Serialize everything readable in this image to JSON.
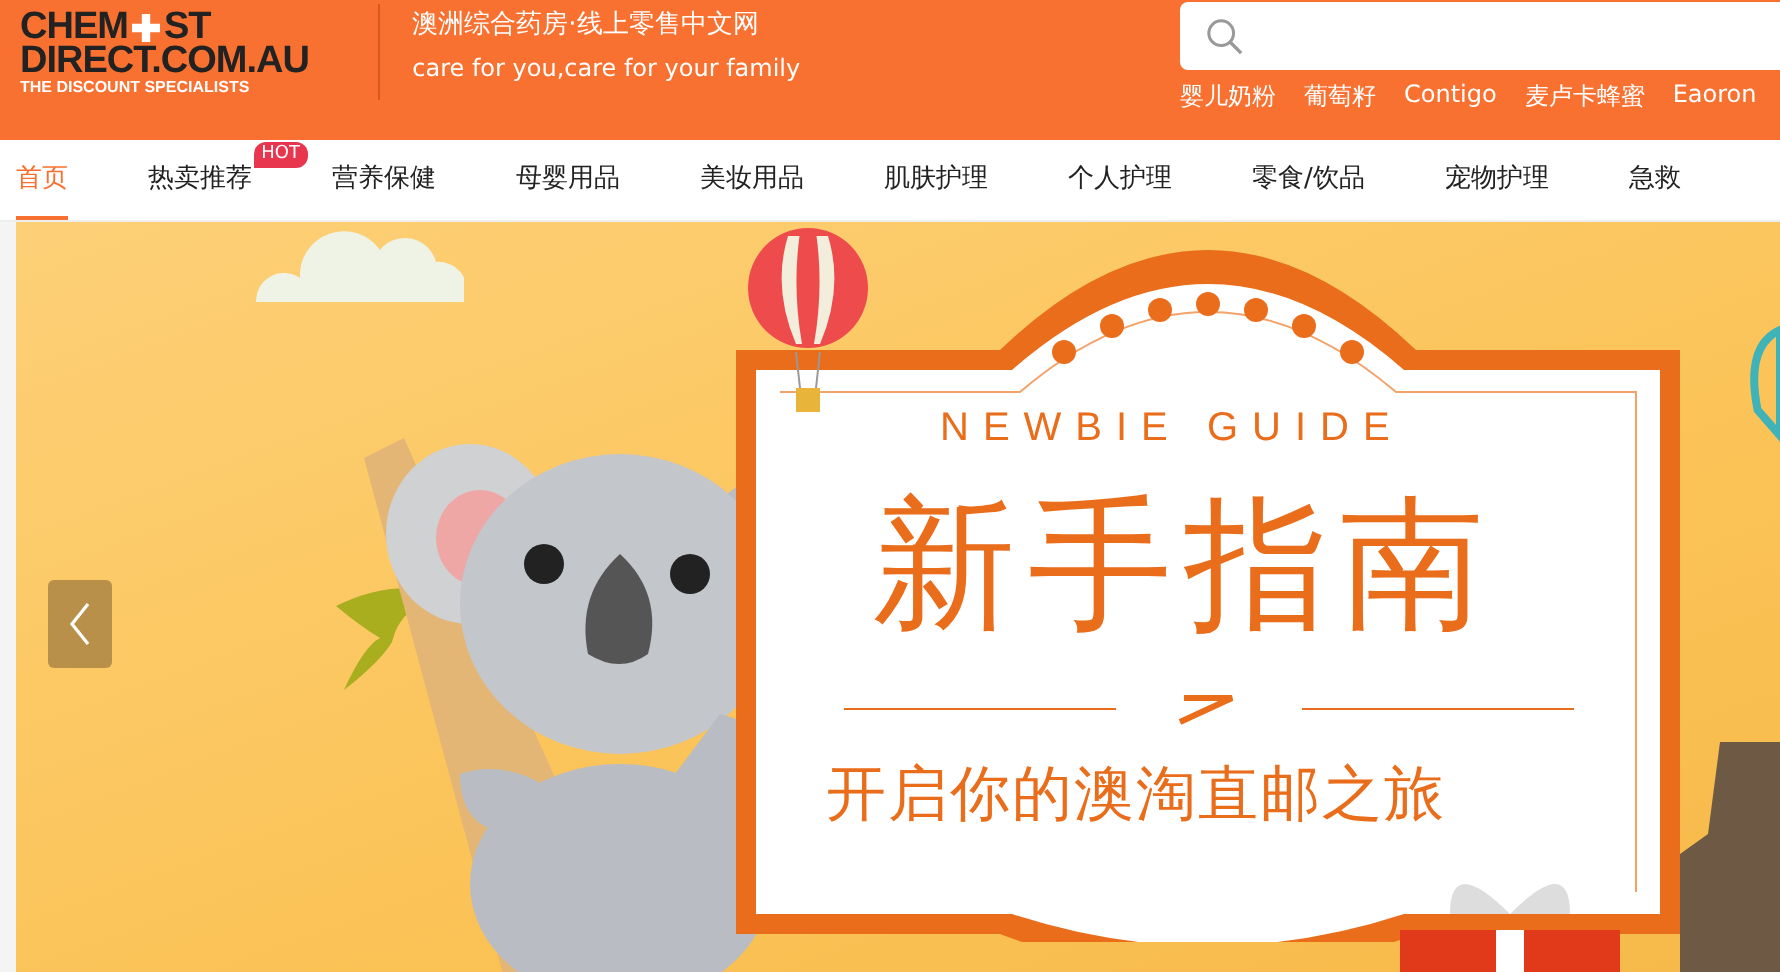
{
  "header": {
    "logo": {
      "word_left": "CHEM",
      "word_right": "ST",
      "domain": "DIRECT.COM.AU",
      "tagline": "THE DISCOUNT SPECIALISTS"
    },
    "slogan_cn": "澳洲综合药房·线上零售中文网",
    "slogan_en": "care for you,care for your family",
    "hot_keywords": [
      "婴儿奶粉",
      "葡萄籽",
      "Contigo",
      "麦卢卡蜂蜜",
      "Eaoron"
    ]
  },
  "nav": [
    {
      "label": "首页",
      "selected": true
    },
    {
      "label": "热卖推荐",
      "selected": false,
      "badge": "HOT"
    },
    {
      "label": "营养保健",
      "selected": false
    },
    {
      "label": "母婴用品",
      "selected": false
    },
    {
      "label": "美妆用品",
      "selected": false
    },
    {
      "label": "肌肤护理",
      "selected": false
    },
    {
      "label": "个人护理",
      "selected": false
    },
    {
      "label": "零食/饮品",
      "selected": false
    },
    {
      "label": "宠物护理",
      "selected": false
    },
    {
      "label": "急救",
      "selected": false
    }
  ],
  "banner": {
    "subtitle_en": "NEWBIE GUIDE",
    "title": "新手指南",
    "caption": "开启你的澳淘直邮之旅"
  }
}
